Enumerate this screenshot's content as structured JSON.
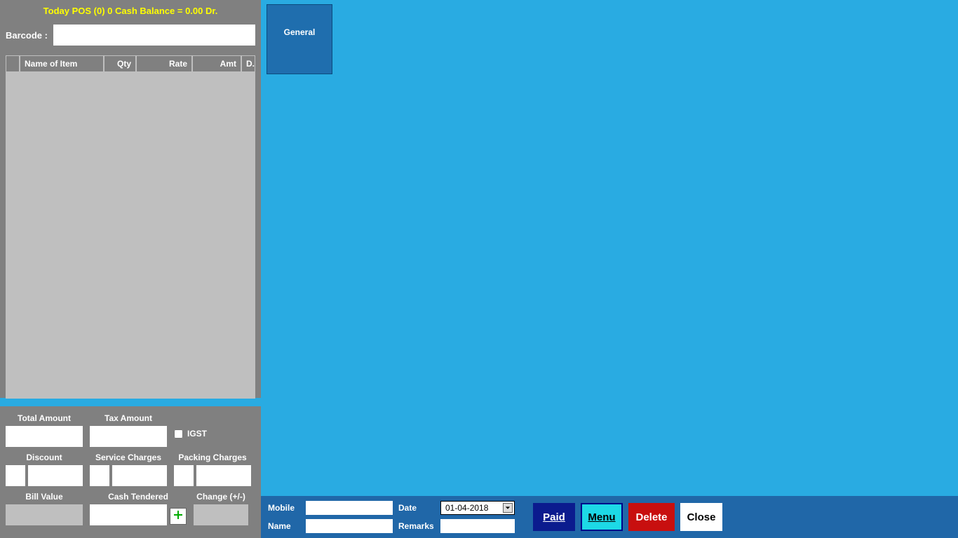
{
  "header": {
    "status_line": "Today POS (0) 0   Cash Balance = 0.00 Dr.",
    "barcode_label": "Barcode :",
    "barcode_value": ""
  },
  "items_table": {
    "columns": {
      "name": "Name of Item",
      "qty": "Qty",
      "rate": "Rate",
      "amt": "Amt",
      "dd": "D.."
    },
    "rows": []
  },
  "totals": {
    "total_amount_label": "Total Amount",
    "tax_amount_label": "Tax Amount",
    "igst_label": "IGST",
    "discount_label": "Discount",
    "service_charges_label": "Service Charges",
    "packing_charges_label": "Packing Charges",
    "bill_value_label": "Bill Value",
    "cash_tendered_label": "Cash Tendered",
    "change_label": "Change (+/-)",
    "total_amount": "",
    "tax_amount": "",
    "igst_checked": false,
    "discount_pct": "",
    "discount_val": "",
    "service_pct": "",
    "service_val": "",
    "packing_pct": "",
    "packing_val": "",
    "bill_value": "",
    "cash_tendered": "",
    "change": ""
  },
  "categories": [
    {
      "label": "General"
    }
  ],
  "bottom": {
    "mobile_label": "Mobile",
    "name_label": "Name",
    "date_label": "Date",
    "remarks_label": "Remarks",
    "mobile_value": "",
    "name_value": "",
    "date_value": "01-04-2018",
    "remarks_value": "",
    "paid_label": "Paid",
    "menu_label": "Menu",
    "delete_label": "Delete",
    "close_label": "Close"
  }
}
